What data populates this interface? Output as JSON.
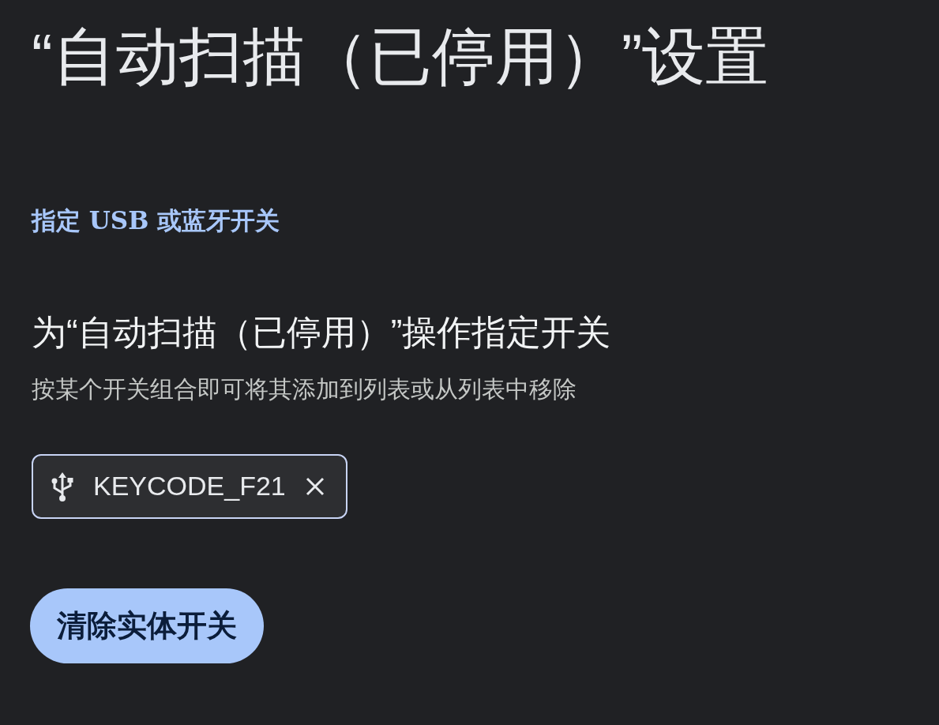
{
  "title": "“自动扫描（已停用）”设置",
  "section_label": "指定 USB 或蓝牙开关",
  "assign": {
    "heading": "为“自动扫描（已停用）”操作指定开关",
    "description": "按某个开关组合即可将其添加到列表或从列表中移除"
  },
  "chips": [
    {
      "label": "KEYCODE_F21"
    }
  ],
  "button": {
    "label": "清除实体开关"
  }
}
